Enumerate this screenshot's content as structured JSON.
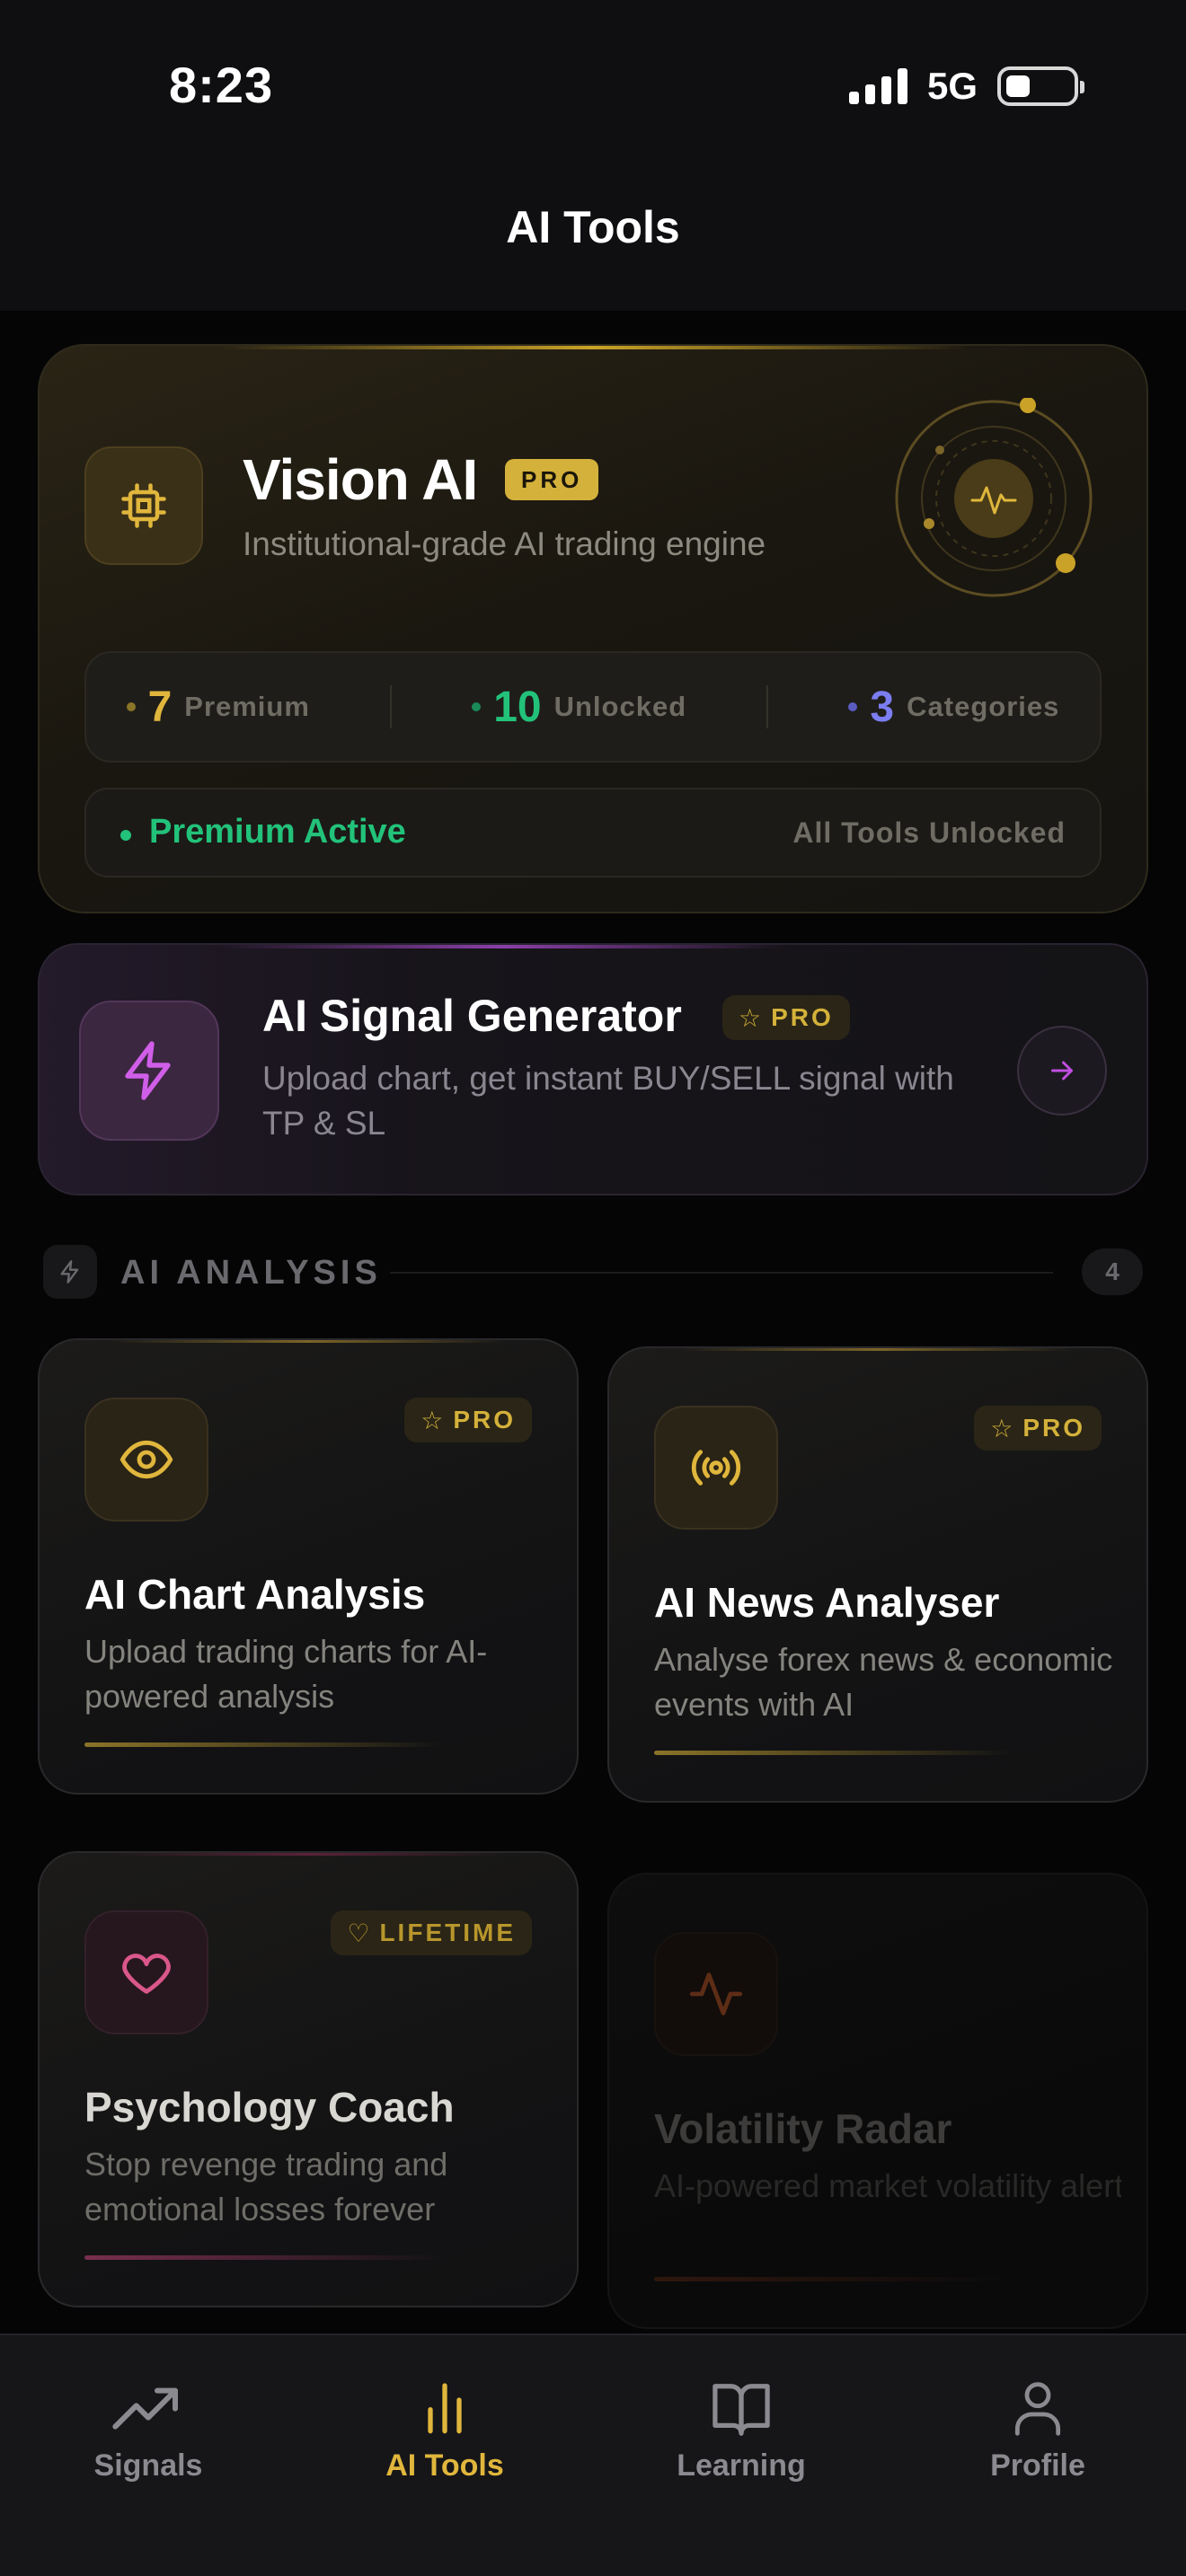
{
  "status_bar": {
    "time": "8:23",
    "network": "5G"
  },
  "header": {
    "title": "AI Tools"
  },
  "vision": {
    "title": "Vision AI",
    "badge": "PRO",
    "subtitle": "Institutional-grade AI trading engine",
    "stats": [
      {
        "value": "7",
        "label": "Premium",
        "color": "#e0b63c"
      },
      {
        "value": "10",
        "label": "Unlocked",
        "color": "#22c27a"
      },
      {
        "value": "3",
        "label": "Categories",
        "color": "#7b7df0"
      }
    ],
    "status_active": "Premium Active",
    "status_right": "All Tools Unlocked"
  },
  "signal_generator": {
    "title": "AI Signal Generator",
    "badge": "PRO",
    "description": "Upload chart, get instant BUY/SELL signal with TP & SL"
  },
  "section": {
    "title": "AI ANALYSIS",
    "count": "4"
  },
  "tools": [
    {
      "title": "AI Chart Analysis",
      "description": "Upload trading charts for AI-powered analysis",
      "badge": "PRO",
      "icon": "eye-icon",
      "accent": "#e0b63c"
    },
    {
      "title": "AI News Analyser",
      "description": "Analyse forex news & economic events with AI",
      "badge": "PRO",
      "icon": "broadcast-icon",
      "accent": "#e0b63c"
    },
    {
      "title": "Psychology Coach",
      "description": "Stop revenge trading and emotional losses forever",
      "badge": "LIFETIME",
      "icon": "heart-icon",
      "accent": "#d9578a"
    },
    {
      "title": "Volatility Radar",
      "description": "AI-powered market volatility alerts and news…",
      "icon": "pulse-icon",
      "accent": "#d8642e"
    }
  ],
  "nav": [
    {
      "label": "Signals",
      "icon": "trending-up-icon",
      "active": false
    },
    {
      "label": "AI Tools",
      "icon": "bar-chart-icon",
      "active": true
    },
    {
      "label": "Learning",
      "icon": "book-icon",
      "active": false
    },
    {
      "label": "Profile",
      "icon": "user-icon",
      "active": false
    }
  ],
  "colors": {
    "gold": "#e0b63c",
    "green": "#22c27a",
    "purple": "#c04ee0",
    "background": "#050506"
  }
}
